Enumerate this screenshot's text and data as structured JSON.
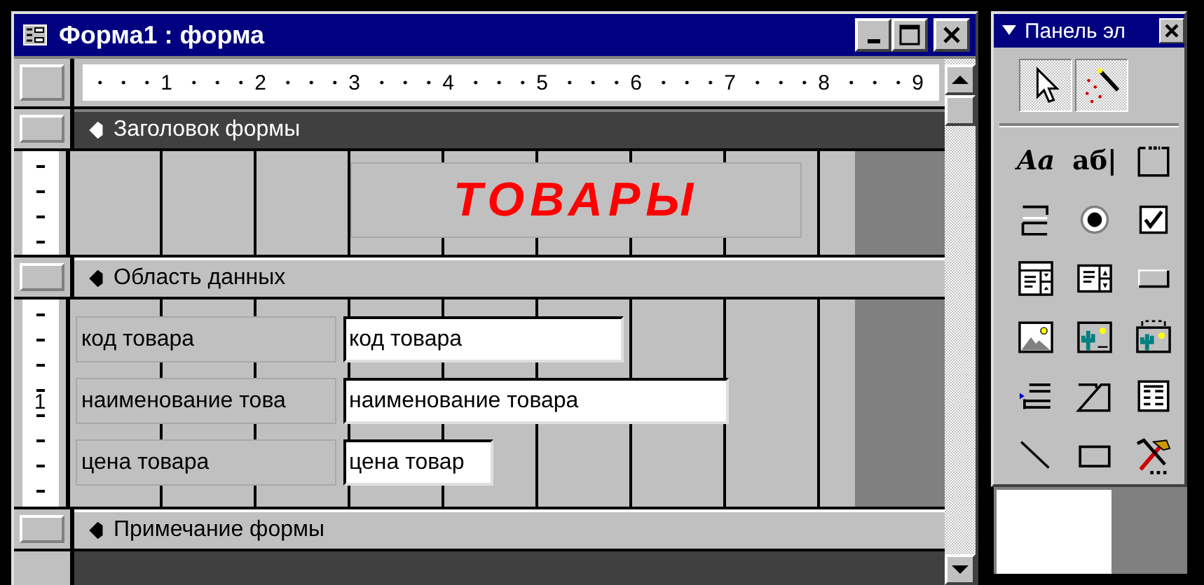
{
  "window": {
    "title": "Форма1 : форма"
  },
  "ruler": {
    "numbers": [
      "1",
      "2",
      "3",
      "4",
      "5",
      "6",
      "7",
      "8",
      "9"
    ],
    "vertical_numbers": [
      "1"
    ]
  },
  "sections": [
    {
      "kind": "header",
      "title": "Заголовок формы"
    },
    {
      "kind": "header-content",
      "caption": "ТОВАРЫ"
    },
    {
      "kind": "bar",
      "title": "Область данных"
    },
    {
      "kind": "detail",
      "rows": [
        {
          "label": "код товара",
          "field": "код товара"
        },
        {
          "label": "наименование това",
          "field": "наименование товара"
        },
        {
          "label": "цена товара",
          "field": "цена товар"
        }
      ]
    },
    {
      "kind": "bar",
      "title": "Примечание формы"
    }
  ],
  "toolbox": {
    "title": "Панель эл",
    "mode_buttons": [
      {
        "kind": "pointer",
        "pressed": true
      },
      {
        "kind": "wizard",
        "pressed": true
      }
    ],
    "tools": [
      {
        "kind": "label",
        "label": "Aa"
      },
      {
        "kind": "textbox",
        "label": "аб|"
      },
      {
        "kind": "group"
      },
      {
        "kind": "toggle"
      },
      {
        "kind": "option"
      },
      {
        "kind": "checkbox"
      },
      {
        "kind": "combo"
      },
      {
        "kind": "list"
      },
      {
        "kind": "button"
      },
      {
        "kind": "image"
      },
      {
        "kind": "frame"
      },
      {
        "kind": "bound-frame"
      },
      {
        "kind": "page-break"
      },
      {
        "kind": "tab"
      },
      {
        "kind": "subform"
      },
      {
        "kind": "line"
      },
      {
        "kind": "rectangle"
      },
      {
        "kind": "more"
      }
    ]
  }
}
